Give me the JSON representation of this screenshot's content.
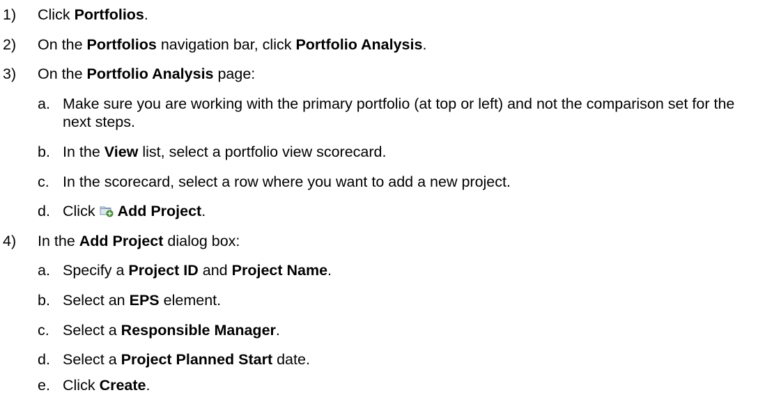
{
  "steps": [
    {
      "num": "1)",
      "parts": [
        {
          "t": "Click "
        },
        {
          "b": "Portfolios"
        },
        {
          "t": "."
        }
      ]
    },
    {
      "num": "2)",
      "parts": [
        {
          "t": "On the "
        },
        {
          "b": "Portfolios"
        },
        {
          "t": " navigation bar, click "
        },
        {
          "b": "Portfolio Analysis"
        },
        {
          "t": "."
        }
      ]
    },
    {
      "num": "3)",
      "parts": [
        {
          "t": "On the "
        },
        {
          "b": "Portfolio Analysis"
        },
        {
          "t": " page:"
        }
      ],
      "subs": [
        {
          "letter": "a.",
          "parts": [
            {
              "t": "Make sure you are working with the primary portfolio (at top or left) and not the comparison set for the next steps."
            }
          ]
        },
        {
          "letter": "b.",
          "parts": [
            {
              "t": "In the "
            },
            {
              "b": "View"
            },
            {
              "t": " list, select a portfolio view scorecard."
            }
          ]
        },
        {
          "letter": "c.",
          "parts": [
            {
              "t": "In the scorecard, select a row where you want to add a new project."
            }
          ]
        },
        {
          "letter": "d.",
          "parts": [
            {
              "t": "Click "
            },
            {
              "icon": "add-project-icon"
            },
            {
              "b": "Add Project"
            },
            {
              "t": "."
            }
          ]
        }
      ]
    },
    {
      "num": "4)",
      "parts": [
        {
          "t": "In the "
        },
        {
          "b": "Add Project"
        },
        {
          "t": " dialog box:"
        }
      ],
      "subs": [
        {
          "letter": "a.",
          "parts": [
            {
              "t": "Specify a "
            },
            {
              "b": "Project ID"
            },
            {
              "t": " and "
            },
            {
              "b": "Project Name"
            },
            {
              "t": "."
            }
          ]
        },
        {
          "letter": "b.",
          "parts": [
            {
              "t": "Select an "
            },
            {
              "b": "EPS"
            },
            {
              "t": " element."
            }
          ]
        },
        {
          "letter": "c.",
          "parts": [
            {
              "t": "Select a "
            },
            {
              "b": "Responsible Manager"
            },
            {
              "t": "."
            }
          ]
        },
        {
          "letter": "d.",
          "parts": [
            {
              "t": "Select a "
            },
            {
              "b": "Project Planned Start"
            },
            {
              "t": " date."
            }
          ]
        },
        {
          "letter": "e.",
          "parts": [
            {
              "t": "Click "
            },
            {
              "b": "Create"
            },
            {
              "t": "."
            }
          ]
        }
      ]
    }
  ]
}
